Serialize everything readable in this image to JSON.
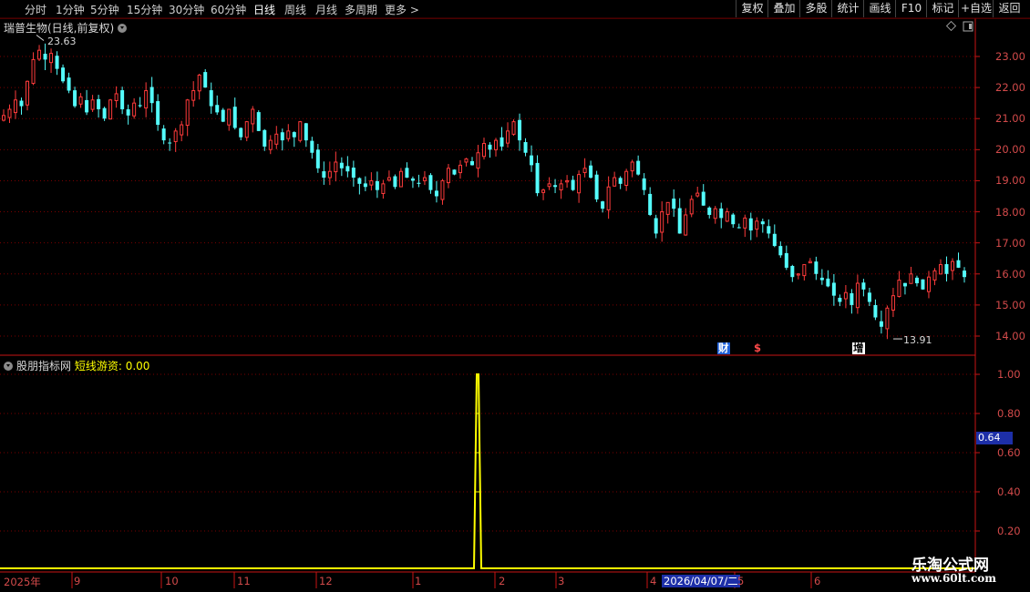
{
  "toolbar": {
    "periods": [
      "分时",
      "1分钟",
      "5分钟",
      "15分钟",
      "30分钟",
      "60分钟",
      "日线",
      "周线",
      "月线",
      "多周期",
      "更多 >"
    ],
    "active_period": "日线",
    "right_buttons": [
      "复权",
      "叠加",
      "多股",
      "统计",
      "画线",
      "F10",
      "标记",
      "+自选",
      "返回"
    ]
  },
  "main_chart": {
    "title": "瑞普生物(日线,前复权)",
    "high_label": "23.63",
    "low_label": "13.91",
    "y_ticks": [
      "23.00",
      "22.00",
      "21.00",
      "20.00",
      "19.00",
      "18.00",
      "17.00",
      "16.00",
      "15.00",
      "14.00"
    ],
    "markers": [
      "财",
      "$",
      "增"
    ]
  },
  "sub_chart": {
    "indicator_name": "股朋指标网",
    "series_label": "短线游资: 0.00",
    "y_ticks": [
      "1.00",
      "0.80",
      "0.60",
      "0.40",
      "0.20"
    ],
    "cursor_value": "0.64"
  },
  "x_axis": {
    "labels": [
      "2025年",
      "9",
      "10",
      "11",
      "12",
      "1",
      "2",
      "3",
      "4",
      "5",
      "6"
    ],
    "cursor_date": "2026/04/07/二"
  },
  "watermark": {
    "name": "乐淘公式网",
    "url": "www.60lt.com"
  },
  "colors": {
    "up": "#ff3b3b",
    "down": "#54fcfc",
    "axis": "#c81414",
    "indicator": "#ffff00",
    "highlight": "#1d2fa8"
  },
  "chart_data": {
    "type": "candlestick",
    "title": "瑞普生物(日线,前复权)",
    "ylim": [
      13.6,
      23.9
    ],
    "note_points": {
      "high": 23.63,
      "low": 13.91
    },
    "closes": [
      21.1,
      21.3,
      21.6,
      21.4,
      22.2,
      22.9,
      23.2,
      22.9,
      23.1,
      22.6,
      22.2,
      21.9,
      21.4,
      21.7,
      21.2,
      21.6,
      21.3,
      21.0,
      21.6,
      21.8,
      21.3,
      21.1,
      21.5,
      21.4,
      21.9,
      21.5,
      20.8,
      20.3,
      20.2,
      20.6,
      20.8,
      21.6,
      21.9,
      22.4,
      22.0,
      21.4,
      21.2,
      20.9,
      21.3,
      20.7,
      20.4,
      20.9,
      21.3,
      20.6,
      20.1,
      20.3,
      20.5,
      20.3,
      20.6,
      20.4,
      20.9,
      20.3,
      19.9,
      19.4,
      19.1,
      19.3,
      19.6,
      19.4,
      19.3,
      19.1,
      18.9,
      18.8,
      19.0,
      18.7,
      18.9,
      19.1,
      18.8,
      19.3,
      19.1,
      19.0,
      18.9,
      19.1,
      18.7,
      18.5,
      19.0,
      19.4,
      19.2,
      19.5,
      19.7,
      19.5,
      19.9,
      20.2,
      20.0,
      20.3,
      20.1,
      20.6,
      20.9,
      20.3,
      19.9,
      19.5,
      18.6,
      18.7,
      18.9,
      18.8,
      18.9,
      19.0,
      18.7,
      19.2,
      19.4,
      19.1,
      18.4,
      18.1,
      18.8,
      19.1,
      18.9,
      19.3,
      19.6,
      19.2,
      18.7,
      17.9,
      17.3,
      18.0,
      18.3,
      18.1,
      17.3,
      17.9,
      18.4,
      18.6,
      18.2,
      17.9,
      18.1,
      17.8,
      18.0,
      17.6,
      17.5,
      17.8,
      17.4,
      17.7,
      17.6,
      17.3,
      16.9,
      16.6,
      16.2,
      15.9,
      16.0,
      16.3,
      16.4,
      16.0,
      15.8,
      15.6,
      15.3,
      15.1,
      15.4,
      15.0,
      15.7,
      15.5,
      15.1,
      14.6,
      14.3,
      14.9,
      15.3,
      15.8,
      15.6,
      16.0,
      15.7,
      15.5,
      15.9,
      16.1,
      16.3,
      16.0,
      16.4,
      16.2,
      15.9
    ]
  }
}
